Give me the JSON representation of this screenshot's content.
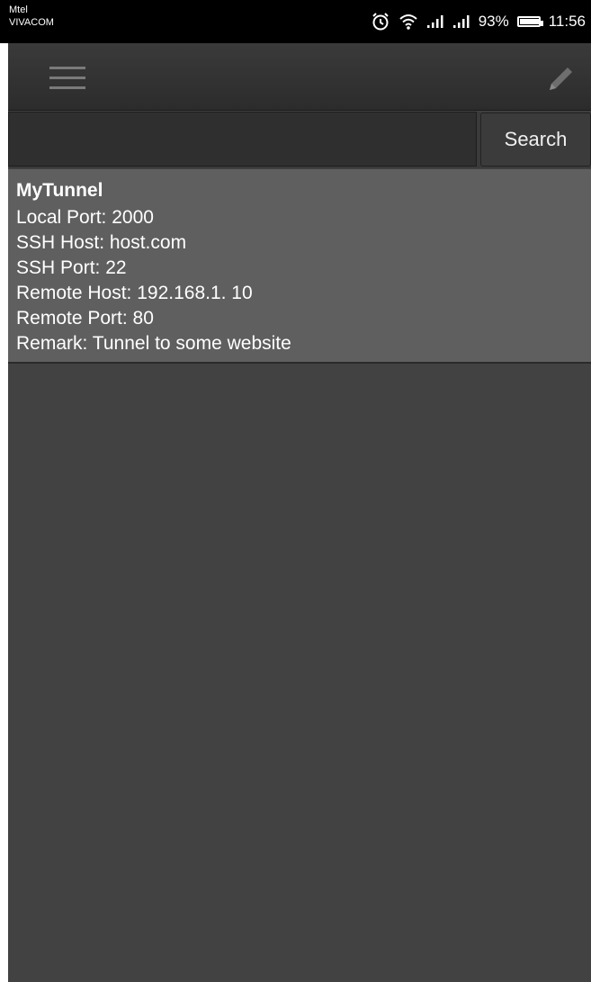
{
  "status_bar": {
    "carrier_line1": "Mtel",
    "carrier_line2": "VIVACOM",
    "battery_percent": "93%",
    "time": "11:56",
    "icons": [
      "alarm-icon",
      "wifi-icon",
      "signal-icon",
      "signal-icon"
    ]
  },
  "action_bar": {
    "menu_icon": "menu-icon",
    "edit_icon": "edit-icon"
  },
  "search": {
    "value": "",
    "placeholder": "",
    "button_label": "Search"
  },
  "tunnels": [
    {
      "name": "MyTunnel",
      "local_port": "Local Port: 2000",
      "ssh_host": "SSH Host: host.com",
      "ssh_port": "SSH Port: 22",
      "remote_host": "Remote Host: 192.168.1. 10",
      "remote_port": "Remote Port: 80",
      "remark": "Remark: Tunnel to some website"
    }
  ],
  "colors": {
    "background": "#424242",
    "action_bar": "#333333",
    "list_item": "#5f5f5f",
    "text": "#ffffff"
  }
}
